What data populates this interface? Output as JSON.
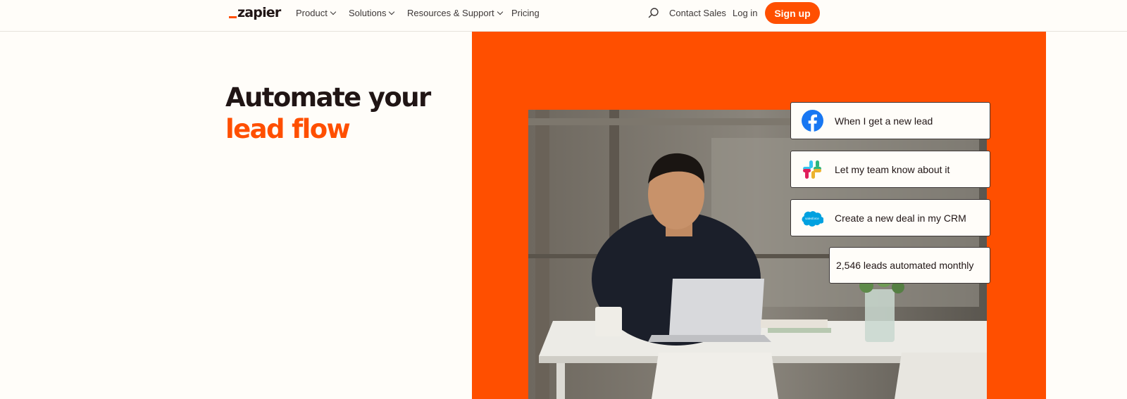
{
  "header": {
    "logo_text": "zapier",
    "nav": [
      {
        "label": "Product",
        "has_dropdown": true
      },
      {
        "label": "Solutions",
        "has_dropdown": true
      },
      {
        "label": "Resources & Support",
        "has_dropdown": true
      },
      {
        "label": "Pricing",
        "has_dropdown": false
      }
    ],
    "search_icon": "search-icon",
    "contact_sales": "Contact Sales",
    "login": "Log in",
    "signup": "Sign up"
  },
  "hero": {
    "headline_line1": "Automate your",
    "headline_line2": "lead flow",
    "panel_color": "#ff4f00",
    "cards": [
      {
        "icon": "facebook-icon",
        "label": "When I get a new lead"
      },
      {
        "icon": "slack-icon",
        "label": "Let my team know about it"
      },
      {
        "icon": "salesforce-icon",
        "label": "Create a new deal in my CRM"
      }
    ],
    "stat": "2,546 leads automated monthly",
    "salesforce_logo_text": "salesforce"
  },
  "colors": {
    "brand": "#ff4f00",
    "background": "#fffdf9",
    "text": "#201515"
  }
}
